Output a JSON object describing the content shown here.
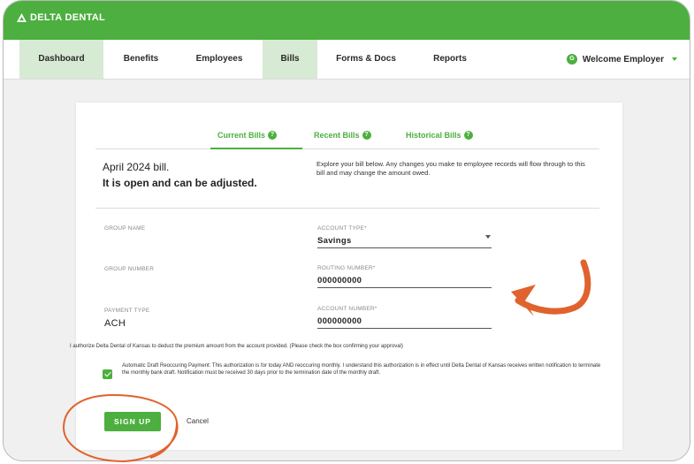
{
  "header": {
    "logo_text": "DELTA DENTAL",
    "logo_icon": "delta-triangle-icon",
    "welcome": "Welcome Employer",
    "avatar_letter": "G",
    "brand_color": "#4caf3f"
  },
  "nav": {
    "items": [
      {
        "label": "Dashboard"
      },
      {
        "label": "Benefits"
      },
      {
        "label": "Employees"
      },
      {
        "label": "Bills"
      },
      {
        "label": "Forms & Docs"
      },
      {
        "label": "Reports"
      }
    ],
    "active": "Bills"
  },
  "tabs": [
    {
      "label": "Current Bills",
      "icon": "question-icon"
    },
    {
      "label": "Recent Bills",
      "icon": "question-icon"
    },
    {
      "label": "Historical Bills",
      "icon": "question-icon"
    }
  ],
  "bill": {
    "month": "April 2024 bill.",
    "status": "It is open and can be adjusted.",
    "explore": "Explore your bill below. Any changes you make to employee records will flow through to this bill and may change the amount owed."
  },
  "form": {
    "group_name_label": "GROUP NAME",
    "group_number_label": "GROUP NUMBER",
    "payment_type_label": "PAYMENT TYPE",
    "payment_type_value": "ACH",
    "account_type_label": "ACCOUNT TYPE*",
    "account_type_value": "Savings",
    "routing_label": "ROUTING NUMBER*",
    "routing_value": "000000000",
    "account_number_label": "ACCOUNT NUMBER*",
    "account_number_value": "000000000"
  },
  "authorize_text": "I authorize Delta Dental of Kansas to deduct the premium amount from the account provided. (Please check the box confirming your approval)",
  "auto_draft_text": "Automatic Draft Reoccuring Payment: This authorization is for today AND reoccuring monthly. I understand this authorization is in effect until Delta Dental of Kansas receives written notification to terminate the monthly bank draft. Notification must be received 30 days prior to the termination date of the monthly draft.",
  "auto_draft_checked": true,
  "actions": {
    "sign_up": "SIGN UP",
    "cancel": "Cancel"
  },
  "annotation_color": "#e0622d"
}
